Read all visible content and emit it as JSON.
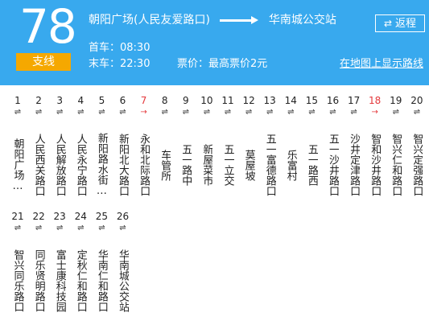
{
  "route": {
    "number": "78",
    "type": "支线",
    "from": "朝阳广场(人民友爱路口)",
    "to": "华南城公交站",
    "first_bus": "首车：08:30",
    "last_bus": "末车：22:30",
    "fare": "票价：最高票价2元",
    "reverse_label": "返程",
    "map_link": "在地图上显示路线"
  },
  "colors": {
    "header_bg": "#38a9ee",
    "badge_bg": "#f5a800",
    "highlight": "#e4393c"
  },
  "direction_marks": {
    "both": "⇌",
    "single": "→"
  },
  "stops": [
    {
      "num": "1",
      "name": "朝阳广场…",
      "highlight": false
    },
    {
      "num": "2",
      "name": "人民西关路口",
      "highlight": false
    },
    {
      "num": "3",
      "name": "人民解放路口",
      "highlight": false
    },
    {
      "num": "4",
      "name": "人民永宁路口",
      "highlight": false
    },
    {
      "num": "5",
      "name": "新阳路水街…",
      "highlight": false
    },
    {
      "num": "6",
      "name": "新阳北大路口",
      "highlight": false
    },
    {
      "num": "7",
      "name": "永和北际路口",
      "highlight": true
    },
    {
      "num": "8",
      "name": "车管所",
      "highlight": false
    },
    {
      "num": "9",
      "name": "五一路中",
      "highlight": false
    },
    {
      "num": "10",
      "name": "新屋菜市",
      "highlight": false
    },
    {
      "num": "11",
      "name": "五一立交",
      "highlight": false
    },
    {
      "num": "12",
      "name": "莫屋坡",
      "highlight": false
    },
    {
      "num": "13",
      "name": "五一富德路口",
      "highlight": false
    },
    {
      "num": "14",
      "name": "乐富村",
      "highlight": false
    },
    {
      "num": "15",
      "name": "五一路西",
      "highlight": false
    },
    {
      "num": "16",
      "name": "五一沙井路口",
      "highlight": false
    },
    {
      "num": "17",
      "name": "沙井定津路口",
      "highlight": false
    },
    {
      "num": "18",
      "name": "智和沙井路口",
      "highlight": true
    },
    {
      "num": "19",
      "name": "智兴仁和路口",
      "highlight": false
    },
    {
      "num": "20",
      "name": "智兴定强路口",
      "highlight": false
    },
    {
      "num": "21",
      "name": "智兴同乐路口",
      "highlight": false
    },
    {
      "num": "22",
      "name": "同乐贤明路口",
      "highlight": false
    },
    {
      "num": "23",
      "name": "富士康科技园",
      "highlight": false
    },
    {
      "num": "24",
      "name": "定秋仁和路口",
      "highlight": false
    },
    {
      "num": "25",
      "name": "华南仁和路口",
      "highlight": false
    },
    {
      "num": "26",
      "name": "华南城公交站",
      "highlight": false
    }
  ]
}
